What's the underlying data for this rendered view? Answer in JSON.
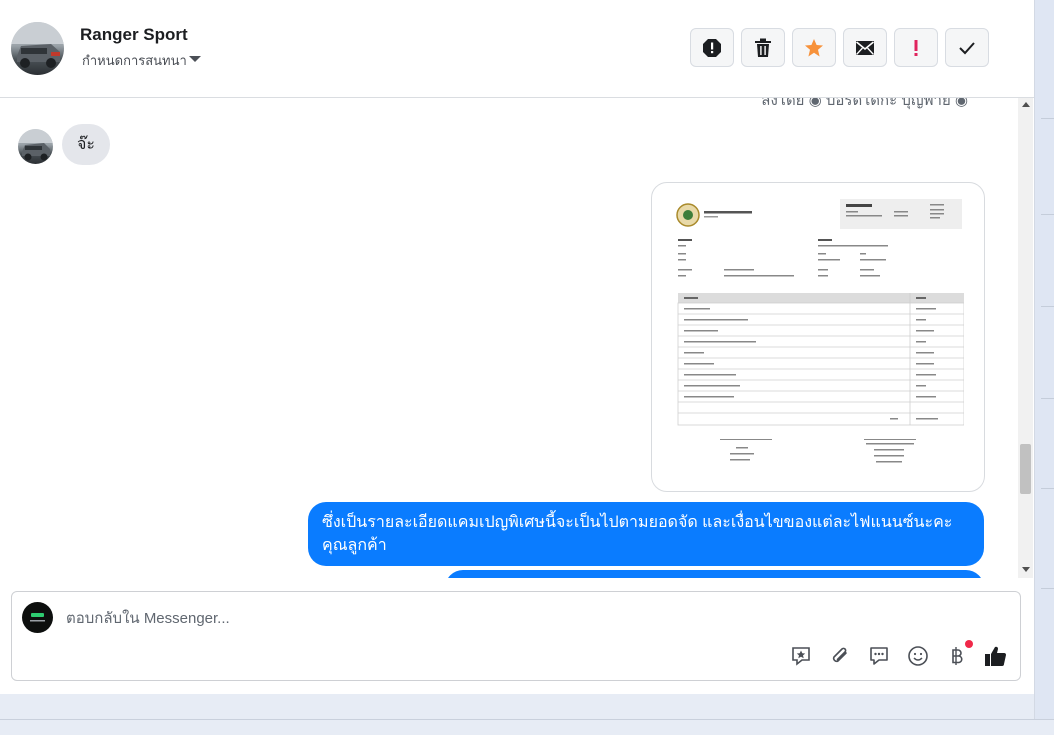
{
  "conversation": {
    "name": "Ranger Sport",
    "subtitle": "กำหนดการสนทนา"
  },
  "actions": [
    {
      "name": "spam",
      "icon": "alert-octagon-icon"
    },
    {
      "name": "delete",
      "icon": "trash-icon"
    },
    {
      "name": "star",
      "icon": "star-icon",
      "color": "#f7923b"
    },
    {
      "name": "mark-unread",
      "icon": "envelope-icon"
    },
    {
      "name": "important",
      "icon": "exclamation-icon",
      "color": "#e0245e"
    },
    {
      "name": "done",
      "icon": "check-icon"
    }
  ],
  "messages": {
    "top_cutoff": "ส่งโดย ◉ บอร์ดโดกะ บุญพาย ◉",
    "incoming_text": "จ๊ะ",
    "attachment": {
      "type": "quotation-image",
      "title": "ใบเสนอราคา"
    },
    "outgoing_text": "ซึ่งเป็นรายละเอียดแคมเปญพิเศษนี้จะเป็นไปตามยอดจัด และเงื่อนไขของแต่ละไฟแนนซ์นะคะคุณลูกค้า"
  },
  "composer": {
    "placeholder": "ตอบกลับใน Messenger...",
    "value": "",
    "tools": [
      "saved-reply-icon",
      "attachment-icon",
      "chat-bubble-icon",
      "emoji-icon",
      "baht-icon",
      "thumbs-up-icon"
    ]
  },
  "colors": {
    "outgoing_bubble": "#0a7cff",
    "incoming_bubble": "#e4e6eb",
    "star": "#f7923b",
    "important": "#e0245e"
  }
}
